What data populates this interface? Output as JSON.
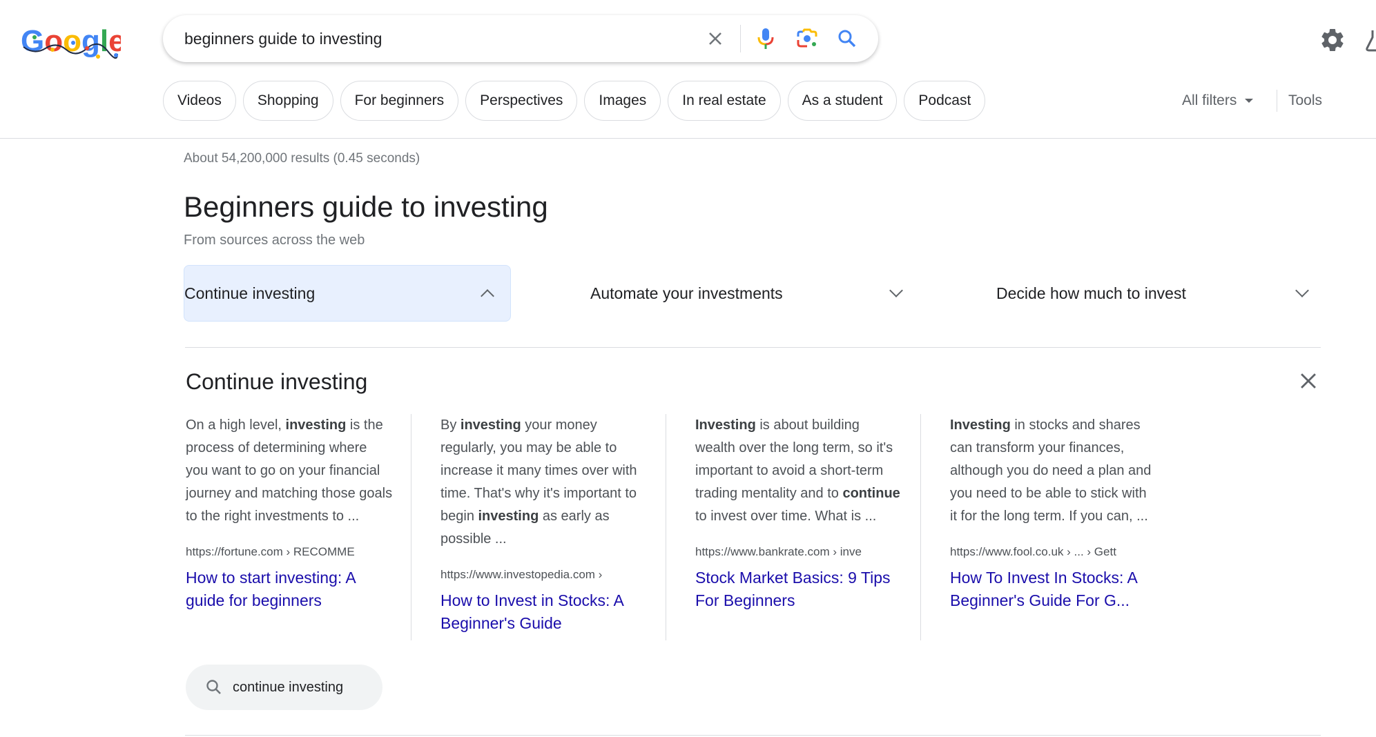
{
  "header": {
    "logo_alt": "Google",
    "search": {
      "query": "beginners guide to investing",
      "clear_icon": "close-icon",
      "voice_icon": "microphone-icon",
      "lens_icon": "camera-lens-icon",
      "search_icon": "search-icon"
    },
    "settings_icon": "gear-icon",
    "labs_icon": "flask-icon"
  },
  "chips": [
    {
      "label": "Videos"
    },
    {
      "label": "Shopping"
    },
    {
      "label": "For beginners"
    },
    {
      "label": "Perspectives"
    },
    {
      "label": "Images"
    },
    {
      "label": "In real estate"
    },
    {
      "label": "As a student"
    },
    {
      "label": "Podcast"
    }
  ],
  "filters": {
    "all_filters": "All filters",
    "tools": "Tools"
  },
  "results": {
    "stats": "About 54,200,000 results (0.45 seconds)",
    "title": "Beginners guide to investing",
    "subtitle": "From sources across the web",
    "accordion": [
      {
        "label": "Continue investing",
        "expanded": true
      },
      {
        "label": "Automate your investments",
        "expanded": false
      },
      {
        "label": "Decide how much to invest",
        "expanded": false
      }
    ],
    "section": {
      "title": "Continue investing",
      "cards": [
        {
          "snippet_parts": [
            [
              "On a high level, ",
              false
            ],
            [
              "investing",
              true
            ],
            [
              " is the process of determining where you want to go on your financial journey and matching those goals to the right investments to ...",
              false
            ]
          ],
          "url": "https://fortune.com › RECOMME",
          "title": "How to start investing: A guide for beginners"
        },
        {
          "snippet_parts": [
            [
              "By ",
              false
            ],
            [
              "investing",
              true
            ],
            [
              " your money regularly, you may be able to increase it many times over with time. That's why it's important to begin ",
              false
            ],
            [
              "investing",
              true
            ],
            [
              " as early as possible ...",
              false
            ]
          ],
          "url": "https://www.investopedia.com ›",
          "title": "How to Invest in Stocks: A Beginner's Guide"
        },
        {
          "snippet_parts": [
            [
              "Investing",
              true
            ],
            [
              " is about building wealth over the long term, so it's important to avoid a short-term trading mentality and to ",
              false
            ],
            [
              "continue",
              true
            ],
            [
              " to invest over time. What is ...",
              false
            ]
          ],
          "url": "https://www.bankrate.com › inve",
          "title": "Stock Market Basics: 9 Tips For Beginners"
        },
        {
          "snippet_parts": [
            [
              "Investing",
              true
            ],
            [
              " in stocks and shares can transform your finances, although you do need a plan and you need to be able to stick with it for the long term. If you can, ...",
              false
            ]
          ],
          "url": "https://www.fool.co.uk › ... › Gett",
          "title": "How To Invest In Stocks: A Beginner's Guide For G..."
        }
      ],
      "related_search": "continue investing"
    }
  },
  "colors": {
    "link": "#1a0dab",
    "accent_blue": "#4285f4",
    "active_tab_bg": "#e8f0fe"
  }
}
